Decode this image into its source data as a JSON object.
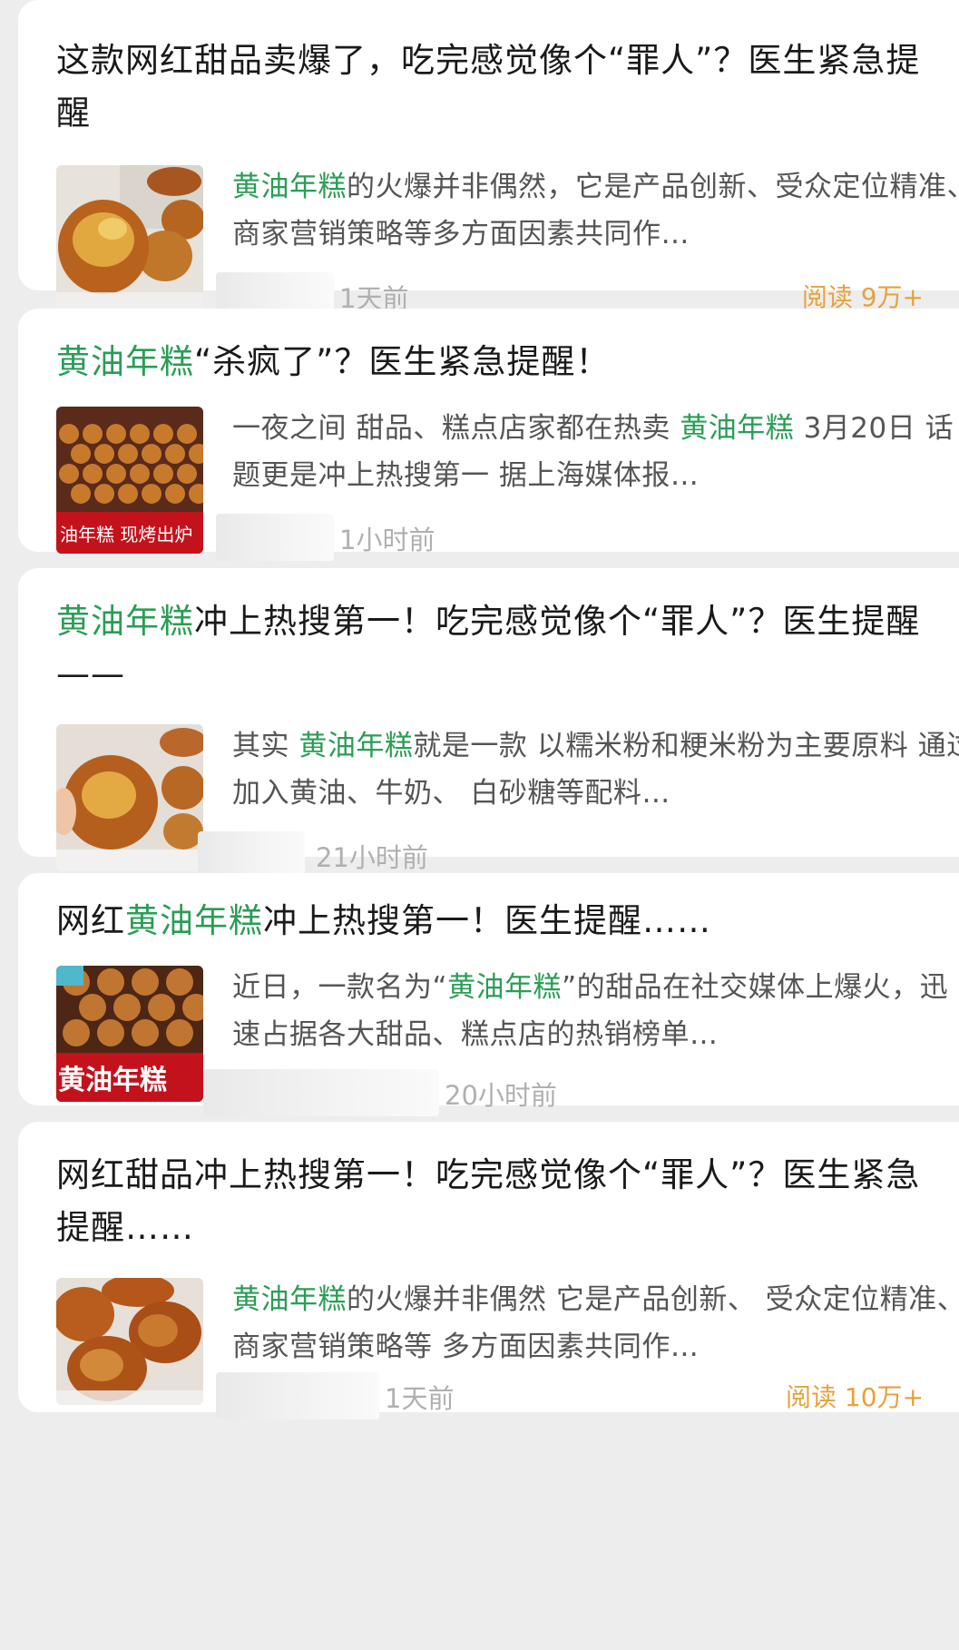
{
  "colors": {
    "highlight": "#2a9d56",
    "reads": "#e6a23c",
    "summary": "#555555",
    "time": "#b0b0b0"
  },
  "cards": [
    {
      "title_pre": "这款网红甜品卖爆了，吃完感觉像个“罪人”？医生紧急提醒",
      "title_hl": "",
      "title_post": "",
      "summary_pre": "",
      "summary_hl": "黄油年糕",
      "summary_post": "的火爆并非偶然，它是产品创新、受众定位精准、商家营销策略等多方面因素共同作…",
      "time": "1天前",
      "reads": "阅读 9万+",
      "thumb": "butter-mochi-cakes-image"
    },
    {
      "title_pre": "",
      "title_hl": "黄油年糕",
      "title_post": "“杀疯了”？医生紧急提醒！",
      "summary_pre": "一夜之间 甜品、糕点店家都在热卖 ",
      "summary_hl": "黄油年糕",
      "summary_post": " 3月20日 话题更是冲上热搜第一 据上海媒体报…",
      "time": "1小时前",
      "reads": "",
      "thumb": "bakery-display-image",
      "thumb_banner": "油年糕 现烤出炉"
    },
    {
      "title_pre": "",
      "title_hl": "黄油年糕",
      "title_post": "冲上热搜第一！吃完感觉像个“罪人”？医生提醒——",
      "summary_pre": "其实 ",
      "summary_hl": "黄油年糕",
      "summary_post": "就是一款 以糯米粉和粳米粉为主要原料 通过加入黄油、牛奶、 白砂糖等配料…",
      "time": "21小时前",
      "reads": "",
      "thumb": "hand-holding-cake-image"
    },
    {
      "title_pre": "网红",
      "title_hl": "黄油年糕",
      "title_post": "冲上热搜第一！医生提醒……",
      "summary_pre": "近日，一款名为“",
      "summary_hl": "黄油年糕",
      "summary_post": "”的甜品在社交媒体上爆火，迅速占据各大甜品、糕点店的热销榜单…",
      "time": "20小时前",
      "reads": "",
      "thumb": "shop-sign-image",
      "thumb_banner": "黄油年糕"
    },
    {
      "title_pre": "网红甜品冲上热搜第一！吃完感觉像个“罪人”？医生紧急提醒……",
      "title_hl": "",
      "title_post": "",
      "summary_pre": "",
      "summary_hl": "黄油年糕",
      "summary_post": "的火爆并非偶然 它是产品创新、 受众定位精准、商家营销策略等 多方面因素共同作…",
      "time": "1天前",
      "reads": "阅读 10万+",
      "thumb": "baked-cakes-closeup-image"
    }
  ]
}
